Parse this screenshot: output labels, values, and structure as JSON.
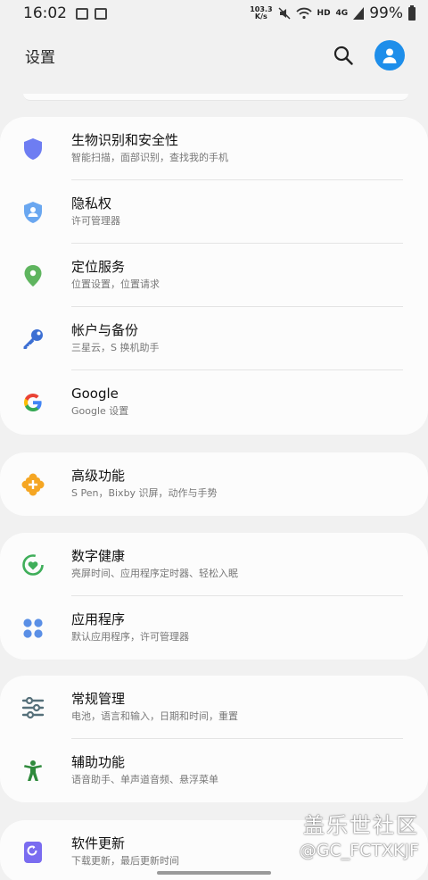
{
  "status_bar": {
    "time": "16:02",
    "net_speed_value": "103.3",
    "net_speed_unit": "K/s",
    "hd_label": "HD",
    "signal_label": "4G",
    "battery": "99%"
  },
  "header": {
    "title": "设置"
  },
  "groups": [
    {
      "items": [
        {
          "title": "生物识别和安全性",
          "subtitle": "智能扫描，面部识别，查找我的手机",
          "icon": "shield-icon",
          "color": "#6e7df2"
        },
        {
          "title": "隐私权",
          "subtitle": "许可管理器",
          "icon": "privacy-shield-icon",
          "color": "#6aa7f0"
        },
        {
          "title": "定位服务",
          "subtitle": "位置设置，位置请求",
          "icon": "location-pin-icon",
          "color": "#5fb55f"
        },
        {
          "title": "帐户与备份",
          "subtitle": "三星云，S 换机助手",
          "icon": "key-icon",
          "color": "#3c6fd3"
        },
        {
          "title": "Google",
          "subtitle": "Google 设置",
          "icon": "google-icon",
          "color": "#4285f4"
        }
      ]
    },
    {
      "items": [
        {
          "title": "高级功能",
          "subtitle": "S Pen，Bixby 识屏，动作与手势",
          "icon": "puzzle-plus-icon",
          "color": "#f5a623"
        }
      ]
    },
    {
      "items": [
        {
          "title": "数字健康",
          "subtitle": "亮屏时间、应用程序定时器、轻松入眠",
          "icon": "wellbeing-heart-icon",
          "color": "#3fae5a"
        },
        {
          "title": "应用程序",
          "subtitle": "默认应用程序，许可管理器",
          "icon": "apps-grid-icon",
          "color": "#5a8fe6"
        }
      ]
    },
    {
      "items": [
        {
          "title": "常规管理",
          "subtitle": "电池，语言和输入，日期和时间，重置",
          "icon": "sliders-icon",
          "color": "#56707a"
        },
        {
          "title": "辅助功能",
          "subtitle": "语音助手、单声道音频、悬浮菜单",
          "icon": "accessibility-icon",
          "color": "#2f8a3c"
        }
      ]
    },
    {
      "items": [
        {
          "title": "软件更新",
          "subtitle": "下载更新，最后更新时间",
          "icon": "software-update-icon",
          "color": "#7a6cf0"
        }
      ]
    }
  ],
  "watermark": {
    "line1": "盖乐世社区",
    "line2": "@GC_FCTXKJF"
  }
}
